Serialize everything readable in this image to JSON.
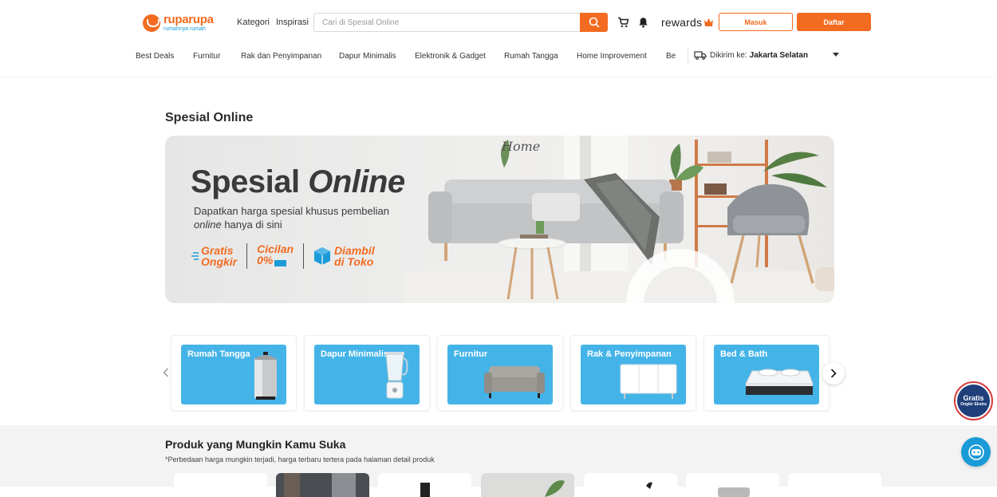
{
  "header": {
    "logo": {
      "name": "ruparupa",
      "tagline": "rumahnya rumah"
    },
    "links": [
      "Kategori",
      "Inspirasi"
    ],
    "search": {
      "placeholder": "Cari di Spesial Online",
      "value": ""
    },
    "icons": [
      "cart-icon",
      "bell-icon"
    ],
    "rewards_label": "rewards",
    "login_label": "Masuk",
    "register_label": "Daftar"
  },
  "nav": {
    "items": [
      "Best Deals",
      "Furnitur",
      "Rak dan Penyimpanan",
      "Dapur Minimalis",
      "Elektronik & Gadget",
      "Rumah Tangga",
      "Home Improvement"
    ],
    "clipped_item": "Be",
    "ship_label": "Dikirim ke:",
    "ship_location": "Jakarta Selatan"
  },
  "main": {
    "title": "Spesial Online",
    "banner": {
      "title_plain": "Spesial",
      "title_italic": "Online",
      "subtitle_1": "Dapatkan harga spesial khusus pembelian",
      "subtitle_italic": "online",
      "subtitle_2": "hanya di sini",
      "badge_gratis_1": "Gratis",
      "badge_gratis_2": "Ongkir",
      "badge_cicilan_1": "Cicilan",
      "badge_cicilan_2": "0%",
      "badge_diambil_1": "Diambil",
      "badge_diambil_2": "di Toko",
      "wall_text": "Home"
    },
    "categories": [
      {
        "label": "Rumah Tangga",
        "icon": "trash-bin-icon"
      },
      {
        "label": "Dapur Minimalis",
        "icon": "blender-icon"
      },
      {
        "label": "Furnitur",
        "icon": "sofa-icon"
      },
      {
        "label": "Rak & Penyimpanan",
        "icon": "cabinet-icon"
      },
      {
        "label": "Bed & Bath",
        "icon": "mattress-icon"
      }
    ]
  },
  "products": {
    "title": "Produk yang Mungkin Kamu Suka",
    "note": "*Perbedaan harga mungkin terjadi, harga terbaru tertera pada halaman detail produk"
  },
  "floating": {
    "gratis_1": "Gratis",
    "gratis_2": "Ongkir Ekstra"
  },
  "colors": {
    "brand": "#f26b21",
    "accent_blue": "#1a9bd7",
    "category_bg": "#44b4e8"
  }
}
